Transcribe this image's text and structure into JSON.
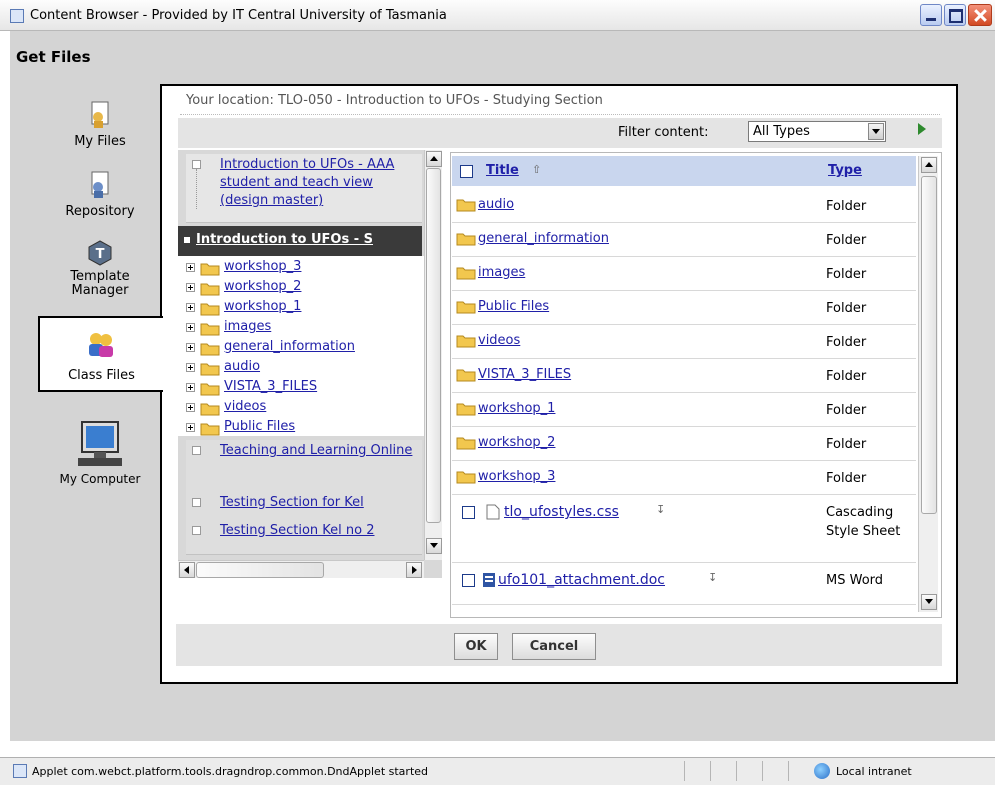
{
  "window": {
    "title": "Content Browser - Provided by IT Central University of Tasmania"
  },
  "heading": "Get Files",
  "nav": [
    {
      "label": "My Files",
      "icon": "my-files-icon"
    },
    {
      "label": "Repository",
      "icon": "repository-icon"
    },
    {
      "label": "Template Manager",
      "icon": "template-manager-icon"
    },
    {
      "label": "Class Files",
      "icon": "class-files-icon",
      "selected": true
    },
    {
      "label": "My Computer",
      "icon": "my-computer-icon"
    }
  ],
  "location": "Your location: TLO-050 - Introduction to UFOs - Studying Section",
  "filter": {
    "label": "Filter content:",
    "selected": "All Types"
  },
  "tree": {
    "sections": [
      {
        "label": "Introduction to UFOs - AAA student and teach view (design master)"
      },
      {
        "label": "Introduction to UFOs - S",
        "current": true
      },
      {
        "label": "Teaching and Learning Online"
      },
      {
        "label": "Testing Section for Kel"
      },
      {
        "label": "Testing Section Kel no 2"
      }
    ],
    "folders": [
      "workshop_3",
      "workshop_2",
      "workshop_1",
      "images",
      "general_information",
      "audio",
      "VISTA_3_FILES",
      "videos",
      "Public Files"
    ]
  },
  "files": {
    "columns": {
      "title": "Title",
      "type": "Type"
    },
    "rows": [
      {
        "name": "audio",
        "type": "Folder",
        "kind": "folder"
      },
      {
        "name": "general_information",
        "type": "Folder",
        "kind": "folder"
      },
      {
        "name": "images",
        "type": "Folder",
        "kind": "folder"
      },
      {
        "name": "Public Files",
        "type": "Folder",
        "kind": "folder"
      },
      {
        "name": "videos",
        "type": "Folder",
        "kind": "folder"
      },
      {
        "name": "VISTA_3_FILES",
        "type": "Folder",
        "kind": "folder"
      },
      {
        "name": "workshop_1",
        "type": "Folder",
        "kind": "folder"
      },
      {
        "name": "workshop_2",
        "type": "Folder",
        "kind": "folder"
      },
      {
        "name": "workshop_3",
        "type": "Folder",
        "kind": "folder"
      },
      {
        "name": "tlo_ufostyles.css",
        "type": "Cascading Style Sheet",
        "kind": "file"
      },
      {
        "name": "ufo101_attachment.doc",
        "type": "MS Word",
        "kind": "doc"
      }
    ]
  },
  "buttons": {
    "ok": "OK",
    "cancel": "Cancel"
  },
  "status": {
    "text": "Applet com.webct.platform.tools.dragndrop.common.DndApplet started",
    "zone": "Local intranet"
  },
  "colors": {
    "link": "#2020a8",
    "header": "#c9d6ee",
    "current_section": "#3a3a3a",
    "folder": "#f2c74e"
  }
}
